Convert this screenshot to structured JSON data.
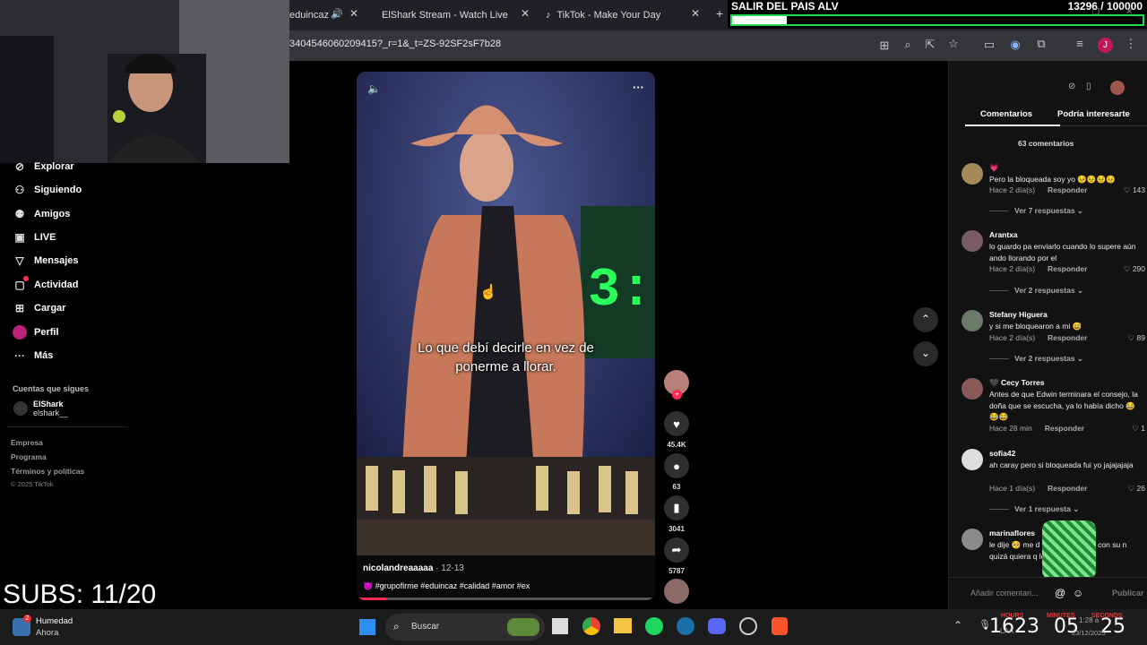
{
  "browser": {
    "tabs": [
      {
        "label": "eduincaz"
      },
      {
        "label": "ElShark Stream - Watch Live on"
      },
      {
        "label": "TikTok - Make Your Day"
      }
    ],
    "url": "3404546060209415?_r=1&_t=ZS-92SF2sF7b28"
  },
  "goal": {
    "title": "SALIR DEL PAIS ALV",
    "count": "13296 / 100000",
    "progress": 0.133
  },
  "sidebar": {
    "items": [
      {
        "label": "Explorar",
        "icon": "compass-icon"
      },
      {
        "label": "Siguiendo",
        "icon": "following-icon"
      },
      {
        "label": "Amigos",
        "icon": "friends-icon"
      },
      {
        "label": "LIVE",
        "icon": "live-icon"
      },
      {
        "label": "Mensajes",
        "icon": "messages-icon"
      },
      {
        "label": "Actividad",
        "icon": "activity-icon"
      },
      {
        "label": "Cargar",
        "icon": "upload-icon"
      },
      {
        "label": "Perfil",
        "icon": "profile-icon"
      },
      {
        "label": "Más",
        "icon": "more-icon"
      }
    ],
    "following_title": "Cuentas que sigues",
    "following_name": "ElShark",
    "following_handle": "elshark__",
    "footer": [
      "Empresa",
      "Programa",
      "Términos y políticas",
      "© 2025 TikTok"
    ]
  },
  "video": {
    "caption_line1": "Lo que debí decirle en vez de",
    "caption_line2": "ponerme a llorar.",
    "author": "nicolandreaaaaa",
    "date": "· 12-13",
    "tags": "😈 #grupofirme #eduincaz #calidad #amor #ex",
    "progress": 0.1
  },
  "actions": {
    "likes": "45.4K",
    "comments": "63",
    "saves": "3041",
    "shares": "5787"
  },
  "comments_panel": {
    "tab_comments": "Comentarios",
    "tab_interest": "Podría interesarte",
    "count": "63 comentarios",
    "reply": "Responder",
    "input_placeholder": "Añadir comentari...",
    "publish": "Publicar",
    "items": [
      {
        "name": "💗",
        "text": "Pero la bloqueada soy yo 😣😣😣😣",
        "time": "Hace 2 día(s)",
        "likes": "143",
        "more": "Ver 7 respuestas ⌄"
      },
      {
        "name": "Arantxa",
        "text": "lo guardo pa enviarlo cuando lo supere aún ando llorando por el",
        "time": "Hace 2 día(s)",
        "likes": "290",
        "more": "Ver 2 respuestas ⌄"
      },
      {
        "name": "Stefany Higuera",
        "text": "y si me bloquearon a mi 😅",
        "time": "Hace 2 día(s)",
        "likes": "89",
        "more": "Ver 2 respuestas ⌄"
      },
      {
        "name": "🖤 Cecy Torres",
        "text": "Antes de que Edwin terminara el consejo, la doña que se escucha, ya lo había dicho 😂😂😂",
        "time": "Hace 28 min",
        "likes": "1",
        "more": ""
      },
      {
        "name": "sofia42",
        "text": "ah caray pero si bloqueada fui yo jajajajaja",
        "time": "Hace 1 día(s)",
        "likes": "26",
        "more": "Ver 1 respuesta ⌄"
      },
      {
        "name": "marinaflores",
        "text": "le dije 🥺 me d                 subió un estado con su n                quizá quiera q lo felic              mi",
        "time": "",
        "likes": "",
        "more": ""
      }
    ]
  },
  "overlay": {
    "subs": "SUBS: 11/20"
  },
  "taskbar": {
    "weather_title": "Humedad",
    "weather_sub": "Ahora",
    "search": "Buscar",
    "clock_big": "1623",
    "clock_mid": "05",
    "clock_right": "25",
    "time_small": "1:28 a",
    "date_small": "23/12/2025",
    "lang": "LAA",
    "timer_labels": [
      "HOURS",
      "MINUTES",
      "SECONDS"
    ]
  }
}
